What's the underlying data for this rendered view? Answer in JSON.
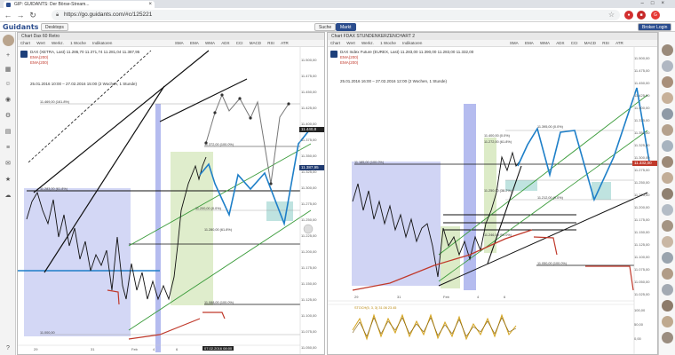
{
  "browser": {
    "tab_title": "GIP: GUIDANTS: Der Börse-Stream...",
    "url": "https://go.guidants.com/#c/125221"
  },
  "app": {
    "logo": "Guidants",
    "header_buttons": [
      "Desktops",
      "Suche",
      "Markt"
    ],
    "broker_button": "Broker Login"
  },
  "left_chart": {
    "title": "Chart Dax 60 Retro",
    "toolbar": [
      "Chart",
      "Wert",
      "Werkz.",
      "1 Woche",
      "Indikatoren",
      "",
      "",
      "",
      "",
      "",
      "",
      "",
      "",
      "",
      "SMA",
      "EMA",
      "WMA",
      "ADX",
      "CCI",
      "MACD",
      "RSI",
      "ATR"
    ],
    "info_lines": [
      "DAX (XETRA, Last)",
      "EMA(200)",
      "EMA(200)"
    ],
    "quote": "11.286,70  11.371,74  11.281,04  11.387,95",
    "range": "25.01.2016 10:00 – 27.02.2016 15:00 (2 Wochen, 1 Stunde)",
    "levels": [
      "11.469,00 (161.8%)",
      "11.372,00 (100.0%)",
      "11.283,00 (61.8%)",
      "11.200,00 (0.0%)",
      "11.088,00 (100.0%)",
      "11.280,00 (61.8%)",
      "11.082,04",
      "11.000,00"
    ],
    "y_ticks": [
      "11.500,00",
      "11.475,00",
      "11.450,00",
      "11.425,00",
      "11.400,00",
      "11.375,00",
      "11.350,00",
      "11.325,00",
      "11.300,00",
      "11.275,00",
      "11.250,00",
      "11.225,00",
      "11.200,00",
      "11.175,00",
      "11.150,00",
      "11.125,00",
      "11.100,00",
      "11.075,00",
      "11.050,00"
    ],
    "price_tags": [
      {
        "text": "11.440,8",
        "color": "#222222"
      },
      {
        "text": "11.387,95",
        "color": "#1f3a70"
      }
    ],
    "x_ticks": [
      "29",
      "31",
      "Feb",
      "4",
      "6"
    ],
    "date_label": "07.02.2016 08:00"
  },
  "right_chart": {
    "title": "Chart FDAX STUNDENKERZENCHART 2",
    "toolbar": [
      "Chart",
      "Wert",
      "Werkz.",
      "1 Woche",
      "Indikatoren",
      "",
      "",
      "",
      "",
      "",
      "",
      "",
      "",
      "",
      "SMA",
      "EMA",
      "WMA",
      "ADX",
      "CCI",
      "MACD",
      "RSI",
      "ATR"
    ],
    "info_lines": [
      "DAX Index Future (EUREX, Last)",
      "EMA(200)",
      "EMA(200)"
    ],
    "quote": "11.283,00  11.390,00  11.283,00  11.332,00",
    "range": "25.01.2016 16:00 – 27.02.2016 12:00 (2 Wochen, 1 Stunde)",
    "levels": [
      "11.395,00 (0.0%)",
      "11.400,00 (0.0%)",
      "11.272,00 (61.8%)",
      "11.185,00 (100.0%)",
      "11.250,00 (38.2%)",
      "11.212,00 (0.0%)",
      "11.246,00 (50.0%)",
      "11.050,00 (100.0%)"
    ],
    "y_ticks": [
      "11.500,00",
      "11.475,00",
      "11.450,00",
      "11.425,00",
      "11.400,00",
      "11.375,00",
      "11.350,00",
      "11.325,00",
      "11.300,00",
      "11.275,00",
      "11.250,00",
      "11.225,00",
      "11.200,00",
      "11.175,00",
      "11.150,00",
      "11.125,00",
      "11.100,00",
      "11.075,00",
      "11.050,00",
      "11.025,00"
    ],
    "price_tags": [
      {
        "text": "11.332,00",
        "color": "#c0392b"
      }
    ],
    "x_ticks": [
      "29",
      "31",
      "Feb",
      "4",
      "6"
    ],
    "indicator_label": "STOCH(5, 3, 3)  31.06  23.45",
    "indicator_ticks": [
      "100,00",
      "50,00",
      "0,00"
    ]
  },
  "colors": {
    "accent": "#2b4d8e",
    "selection_blue": "#c8cdf2",
    "selection_green": "#dcebc7",
    "forecast_line": "#1e7fc8",
    "ema_line": "#c0392b",
    "trend_green": "#3a9b3a"
  }
}
